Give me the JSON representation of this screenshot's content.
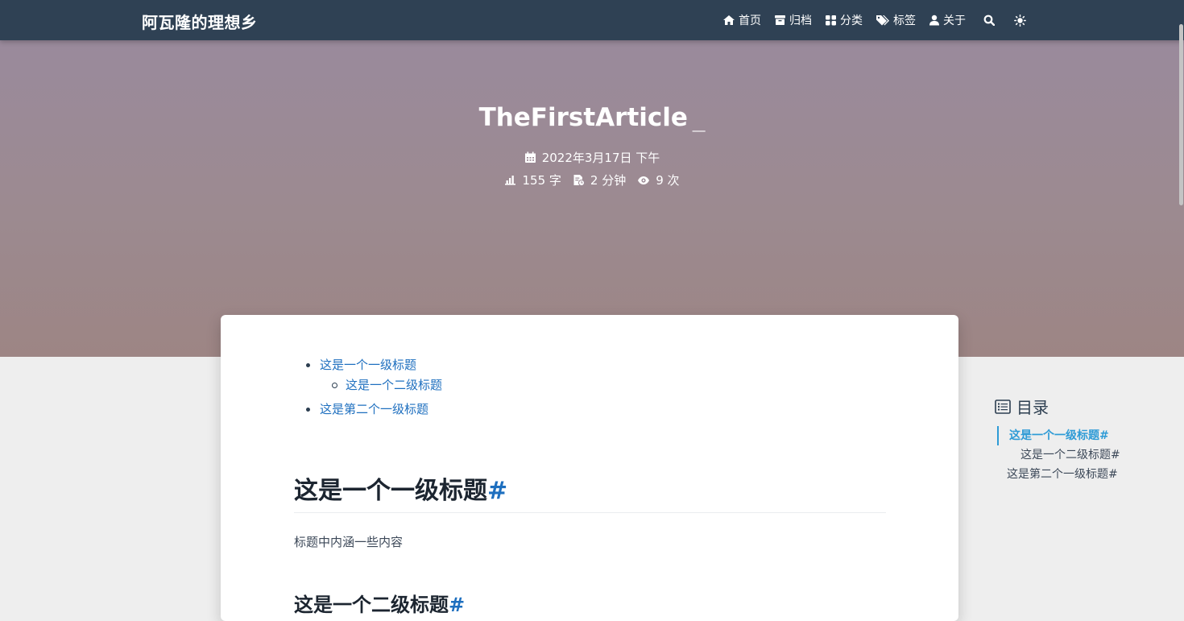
{
  "navbar": {
    "brand": "阿瓦隆的理想乡",
    "items": [
      {
        "label": "首页",
        "icon": "home-icon"
      },
      {
        "label": "归档",
        "icon": "archive-icon"
      },
      {
        "label": "分类",
        "icon": "grid-icon"
      },
      {
        "label": "标签",
        "icon": "tags-icon"
      },
      {
        "label": "关于",
        "icon": "user-icon"
      }
    ],
    "search_icon": "search-icon",
    "theme_icon": "sun-icon"
  },
  "banner": {
    "title": "TheFirstArticle",
    "cursor": "_",
    "date": "2022年3月17日 下午",
    "word_count": "155 字",
    "read_time": "2 分钟",
    "views": "9 次"
  },
  "article": {
    "toc": [
      "这是一个一级标题",
      "这是一个二级标题",
      "这是第二个一级标题"
    ],
    "h1": "这是一个一级标题",
    "h1_anchor": "#",
    "paragraph": "标题中内涵一些内容",
    "h2": "这是一个二级标题",
    "h2_anchor": "#"
  },
  "side_toc": {
    "title": "目录",
    "items": [
      "这是一个一级标题#",
      "这是一个二级标题#",
      "这是第二个一级标题#"
    ]
  },
  "colors": {
    "navbar": "#2f4154",
    "link": "#1e6fbf",
    "active_toc": "#2e9bd6"
  }
}
